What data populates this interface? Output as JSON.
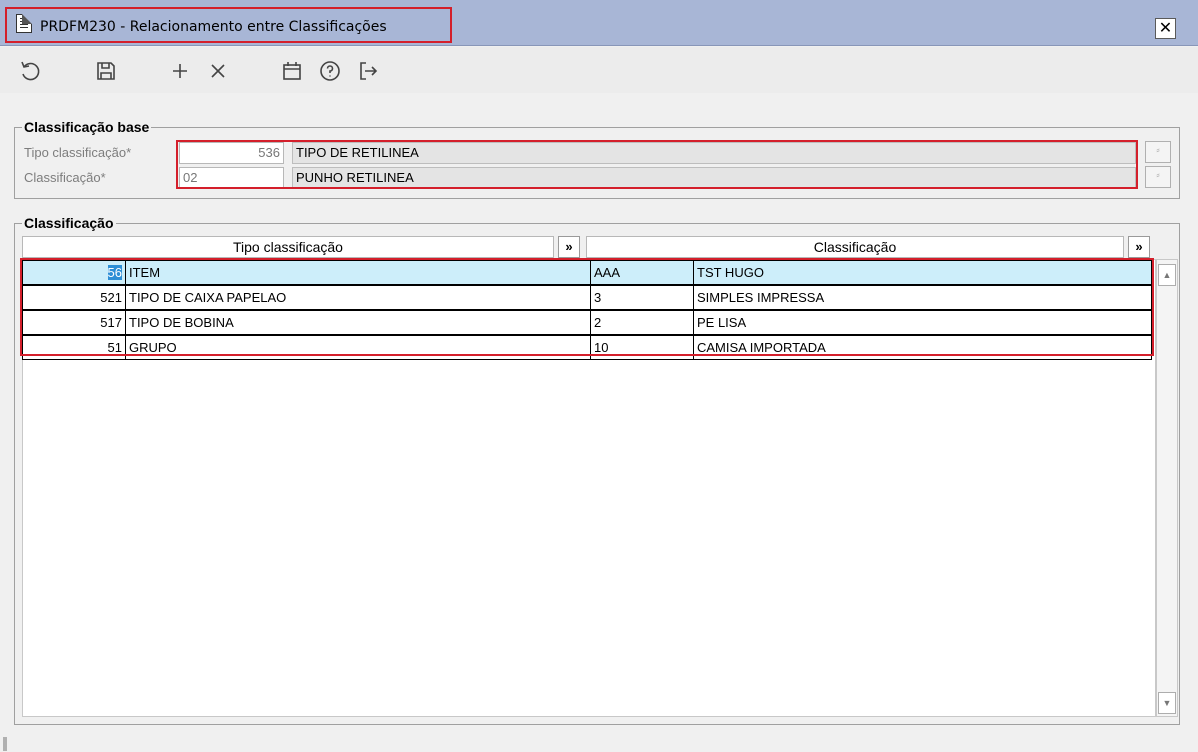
{
  "window": {
    "title": "PRDFM230 - Relacionamento entre Classificações",
    "close_label": "✕"
  },
  "toolbar": {
    "buttons": [
      {
        "name": "undo-button",
        "icon": "undo-icon"
      },
      {
        "name": "save-button",
        "icon": "save-icon"
      },
      {
        "name": "add-button",
        "icon": "plus-icon"
      },
      {
        "name": "delete-button",
        "icon": "close-icon"
      },
      {
        "name": "calendar-button",
        "icon": "calendar-icon"
      },
      {
        "name": "help-button",
        "icon": "help-icon"
      },
      {
        "name": "exit-button",
        "icon": "exit-icon"
      }
    ]
  },
  "base": {
    "title": "Classificação base",
    "tipo": {
      "label": "Tipo classificação*",
      "code": "536",
      "description": "TIPO DE RETILINEA"
    },
    "classificacao": {
      "label": "Classificação*",
      "code": "02",
      "description": "PUNHO RETILINEA"
    },
    "lookup_glyph": "⸗"
  },
  "grid": {
    "title": "Classificação",
    "columns": [
      {
        "label": "Tipo classificação",
        "arrow": "»"
      },
      {
        "label": "Classificação",
        "arrow": "»"
      }
    ],
    "rows": [
      {
        "tipo_code": "56",
        "tipo_desc": "ITEM",
        "class_code": "AAA",
        "class_desc": "TST HUGO"
      },
      {
        "tipo_code": "521",
        "tipo_desc": "TIPO DE CAIXA PAPELAO",
        "class_code": "3",
        "class_desc": "SIMPLES IMPRESSA"
      },
      {
        "tipo_code": "517",
        "tipo_desc": "TIPO DE BOBINA",
        "class_code": "2",
        "class_desc": "PE LISA"
      },
      {
        "tipo_code": "51",
        "tipo_desc": "GRUPO",
        "class_code": "10",
        "class_desc": "CAMISA IMPORTADA"
      }
    ],
    "selected_row": 0,
    "scroll_up": "▲",
    "scroll_down": "▼"
  },
  "colors": {
    "titlebar": "#a8b6d6",
    "highlight_box": "#d41f2b",
    "selected_row": "#cdeefa",
    "selected_cell": "#2e8fd6"
  }
}
